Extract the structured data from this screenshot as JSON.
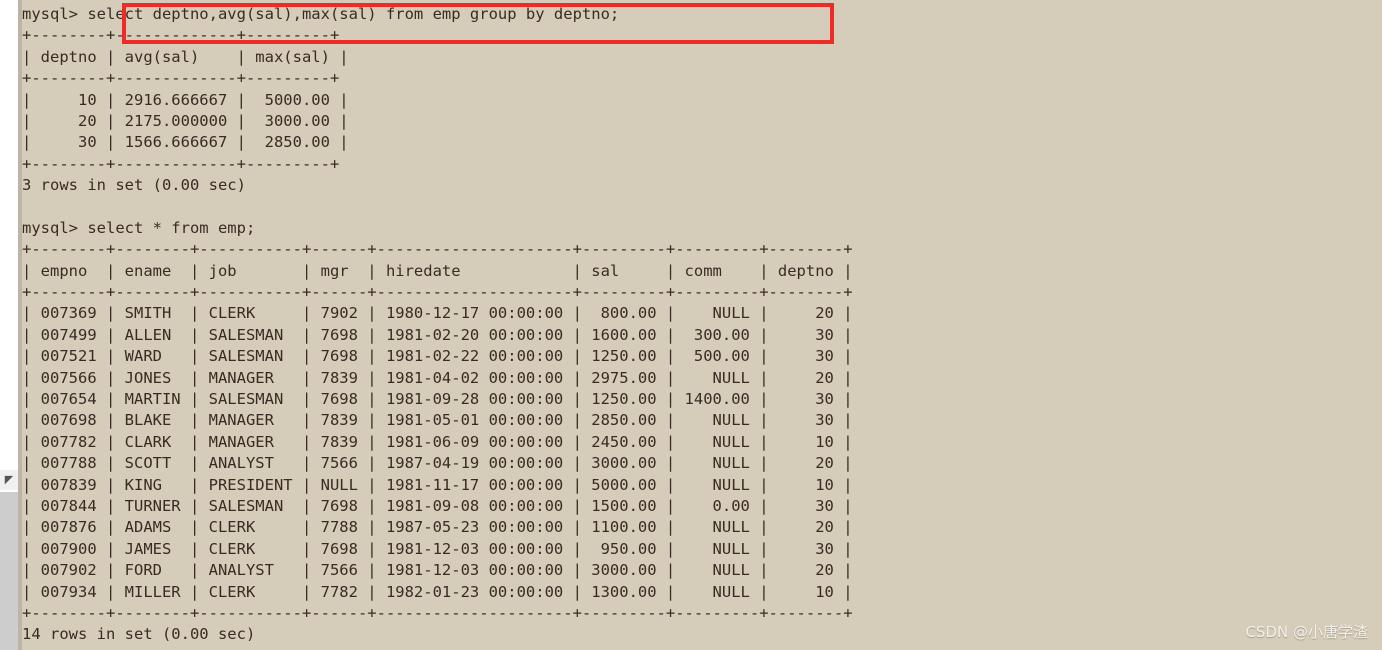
{
  "window": {
    "type": "mysql-terminal",
    "background_color": "#d5cdba",
    "text_color": "#3a2b22",
    "highlight_color": "#ef2b29"
  },
  "watermark": {
    "text": "CSDN @小唐学渣"
  },
  "scrollbar": {
    "arrow_glyph": "◤"
  },
  "console": {
    "lines": [
      "mysql> select deptno,avg(sal),max(sal) from emp group by deptno;",
      "+--------+-------------+---------+",
      "| deptno | avg(sal)    | max(sal) |",
      "+--------+-------------+---------+",
      "|     10 | 2916.666667 |  5000.00 |",
      "|     20 | 2175.000000 |  3000.00 |",
      "|     30 | 1566.666667 |  2850.00 |",
      "+--------+-------------+---------+",
      "3 rows in set (0.00 sec)",
      "",
      "mysql> select * from emp;",
      "+--------+--------+-----------+------+---------------------+---------+---------+--------+",
      "| empno  | ename  | job       | mgr  | hiredate            | sal     | comm    | deptno |",
      "+--------+--------+-----------+------+---------------------+---------+---------+--------+",
      "| 007369 | SMITH  | CLERK     | 7902 | 1980-12-17 00:00:00 |  800.00 |    NULL |     20 |",
      "| 007499 | ALLEN  | SALESMAN  | 7698 | 1981-02-20 00:00:00 | 1600.00 |  300.00 |     30 |",
      "| 007521 | WARD   | SALESMAN  | 7698 | 1981-02-22 00:00:00 | 1250.00 |  500.00 |     30 |",
      "| 007566 | JONES  | MANAGER   | 7839 | 1981-04-02 00:00:00 | 2975.00 |    NULL |     20 |",
      "| 007654 | MARTIN | SALESMAN  | 7698 | 1981-09-28 00:00:00 | 1250.00 | 1400.00 |     30 |",
      "| 007698 | BLAKE  | MANAGER   | 7839 | 1981-05-01 00:00:00 | 2850.00 |    NULL |     30 |",
      "| 007782 | CLARK  | MANAGER   | 7839 | 1981-06-09 00:00:00 | 2450.00 |    NULL |     10 |",
      "| 007788 | SCOTT  | ANALYST   | 7566 | 1987-04-19 00:00:00 | 3000.00 |    NULL |     20 |",
      "| 007839 | KING   | PRESIDENT | NULL | 1981-11-17 00:00:00 | 5000.00 |    NULL |     10 |",
      "| 007844 | TURNER | SALESMAN  | 7698 | 1981-09-08 00:00:00 | 1500.00 |    0.00 |     30 |",
      "| 007876 | ADAMS  | CLERK     | 7788 | 1987-05-23 00:00:00 | 1100.00 |    NULL |     20 |",
      "| 007900 | JAMES  | CLERK     | 7698 | 1981-12-03 00:00:00 |  950.00 |    NULL |     30 |",
      "| 007902 | FORD   | ANALYST   | 7566 | 1981-12-03 00:00:00 | 3000.00 |    NULL |     20 |",
      "| 007934 | MILLER | CLERK     | 7782 | 1982-01-23 00:00:00 | 1300.00 |    NULL |     10 |",
      "+--------+--------+-----------+------+---------------------+---------+---------+--------+",
      "14 rows in set (0.00 sec)"
    ]
  },
  "queries": [
    {
      "prompt": "mysql>",
      "sql": "select deptno,avg(sal),max(sal) from emp group by deptno;",
      "highlighted": true,
      "status": "3 rows in set (0.00 sec)",
      "result": {
        "columns": [
          "deptno",
          "avg(sal)",
          "max(sal)"
        ],
        "rows": [
          [
            "10",
            "2916.666667",
            "5000.00"
          ],
          [
            "20",
            "2175.000000",
            "3000.00"
          ],
          [
            "30",
            "1566.666667",
            "2850.00"
          ]
        ]
      }
    },
    {
      "prompt": "mysql>",
      "sql": "select * from emp;",
      "highlighted": false,
      "status": "14 rows in set (0.00 sec)",
      "result": {
        "columns": [
          "empno",
          "ename",
          "job",
          "mgr",
          "hiredate",
          "sal",
          "comm",
          "deptno"
        ],
        "rows": [
          [
            "007369",
            "SMITH",
            "CLERK",
            "7902",
            "1980-12-17 00:00:00",
            "800.00",
            "NULL",
            "20"
          ],
          [
            "007499",
            "ALLEN",
            "SALESMAN",
            "7698",
            "1981-02-20 00:00:00",
            "1600.00",
            "300.00",
            "30"
          ],
          [
            "007521",
            "WARD",
            "SALESMAN",
            "7698",
            "1981-02-22 00:00:00",
            "1250.00",
            "500.00",
            "30"
          ],
          [
            "007566",
            "JONES",
            "MANAGER",
            "7839",
            "1981-04-02 00:00:00",
            "2975.00",
            "NULL",
            "20"
          ],
          [
            "007654",
            "MARTIN",
            "SALESMAN",
            "7698",
            "1981-09-28 00:00:00",
            "1250.00",
            "1400.00",
            "30"
          ],
          [
            "007698",
            "BLAKE",
            "MANAGER",
            "7839",
            "1981-05-01 00:00:00",
            "2850.00",
            "NULL",
            "30"
          ],
          [
            "007782",
            "CLARK",
            "MANAGER",
            "7839",
            "1981-06-09 00:00:00",
            "2450.00",
            "NULL",
            "10"
          ],
          [
            "007788",
            "SCOTT",
            "ANALYST",
            "7566",
            "1987-04-19 00:00:00",
            "3000.00",
            "NULL",
            "20"
          ],
          [
            "007839",
            "KING",
            "PRESIDENT",
            "NULL",
            "1981-11-17 00:00:00",
            "5000.00",
            "NULL",
            "10"
          ],
          [
            "007844",
            "TURNER",
            "SALESMAN",
            "7698",
            "1981-09-08 00:00:00",
            "1500.00",
            "0.00",
            "30"
          ],
          [
            "007876",
            "ADAMS",
            "CLERK",
            "7788",
            "1987-05-23 00:00:00",
            "1100.00",
            "NULL",
            "20"
          ],
          [
            "007900",
            "JAMES",
            "CLERK",
            "7698",
            "1981-12-03 00:00:00",
            "950.00",
            "NULL",
            "30"
          ],
          [
            "007902",
            "FORD",
            "ANALYST",
            "7566",
            "1981-12-03 00:00:00",
            "3000.00",
            "NULL",
            "20"
          ],
          [
            "007934",
            "MILLER",
            "CLERK",
            "7782",
            "1982-01-23 00:00:00",
            "1300.00",
            "NULL",
            "10"
          ]
        ]
      }
    }
  ]
}
